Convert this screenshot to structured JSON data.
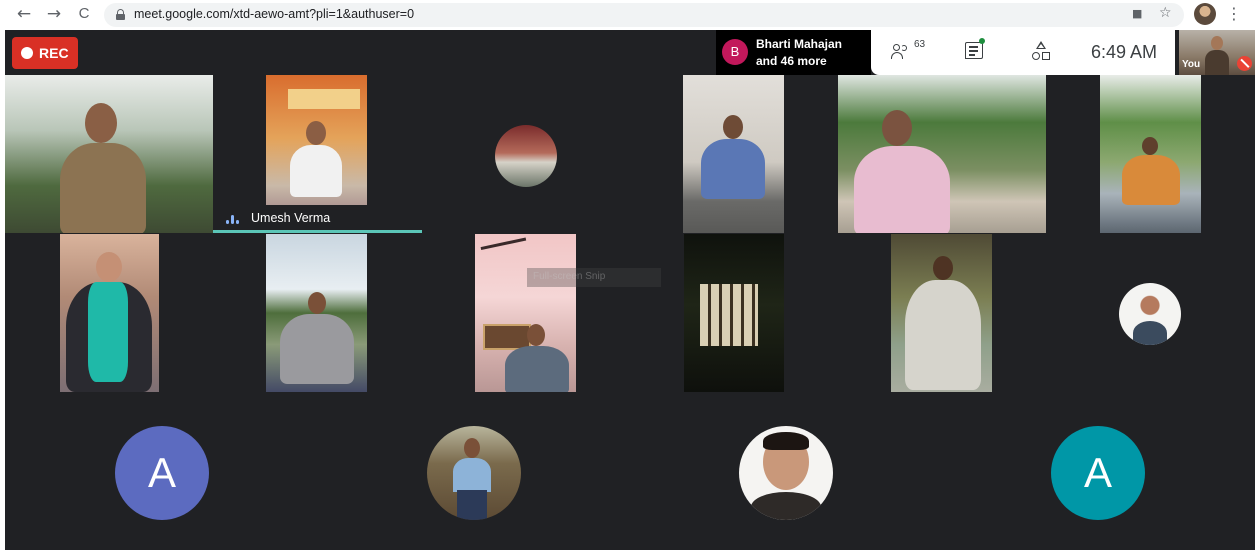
{
  "browser": {
    "url": "meet.google.com/xtd-aewo-amt?pli=1&authuser=0",
    "back_icon": "←",
    "forward_icon": "→",
    "reload_icon": "C",
    "camera_icon": "■",
    "star_icon": "☆",
    "menu_icon": "⋮"
  },
  "meet": {
    "recording_label": "REC",
    "presence": {
      "avatar_letter": "B",
      "line1": "Bharti Mahajan",
      "line2": "and 46 more"
    },
    "people_count": "63",
    "clock": "6:49 AM",
    "self_view_label": "You",
    "active_speaker_name": "Umesh Verma",
    "overlay_text": "Full-screen Snip",
    "letter_avatars": [
      {
        "letter": "A",
        "color": "#5c6bc0"
      },
      {
        "letter": "A",
        "color": "#0097a7"
      }
    ],
    "colors": {
      "rec": "#d93025",
      "stage_background": "#202124",
      "speaking_indicator": "#5bc6b8",
      "presence_avatar": "#c2185b"
    }
  }
}
